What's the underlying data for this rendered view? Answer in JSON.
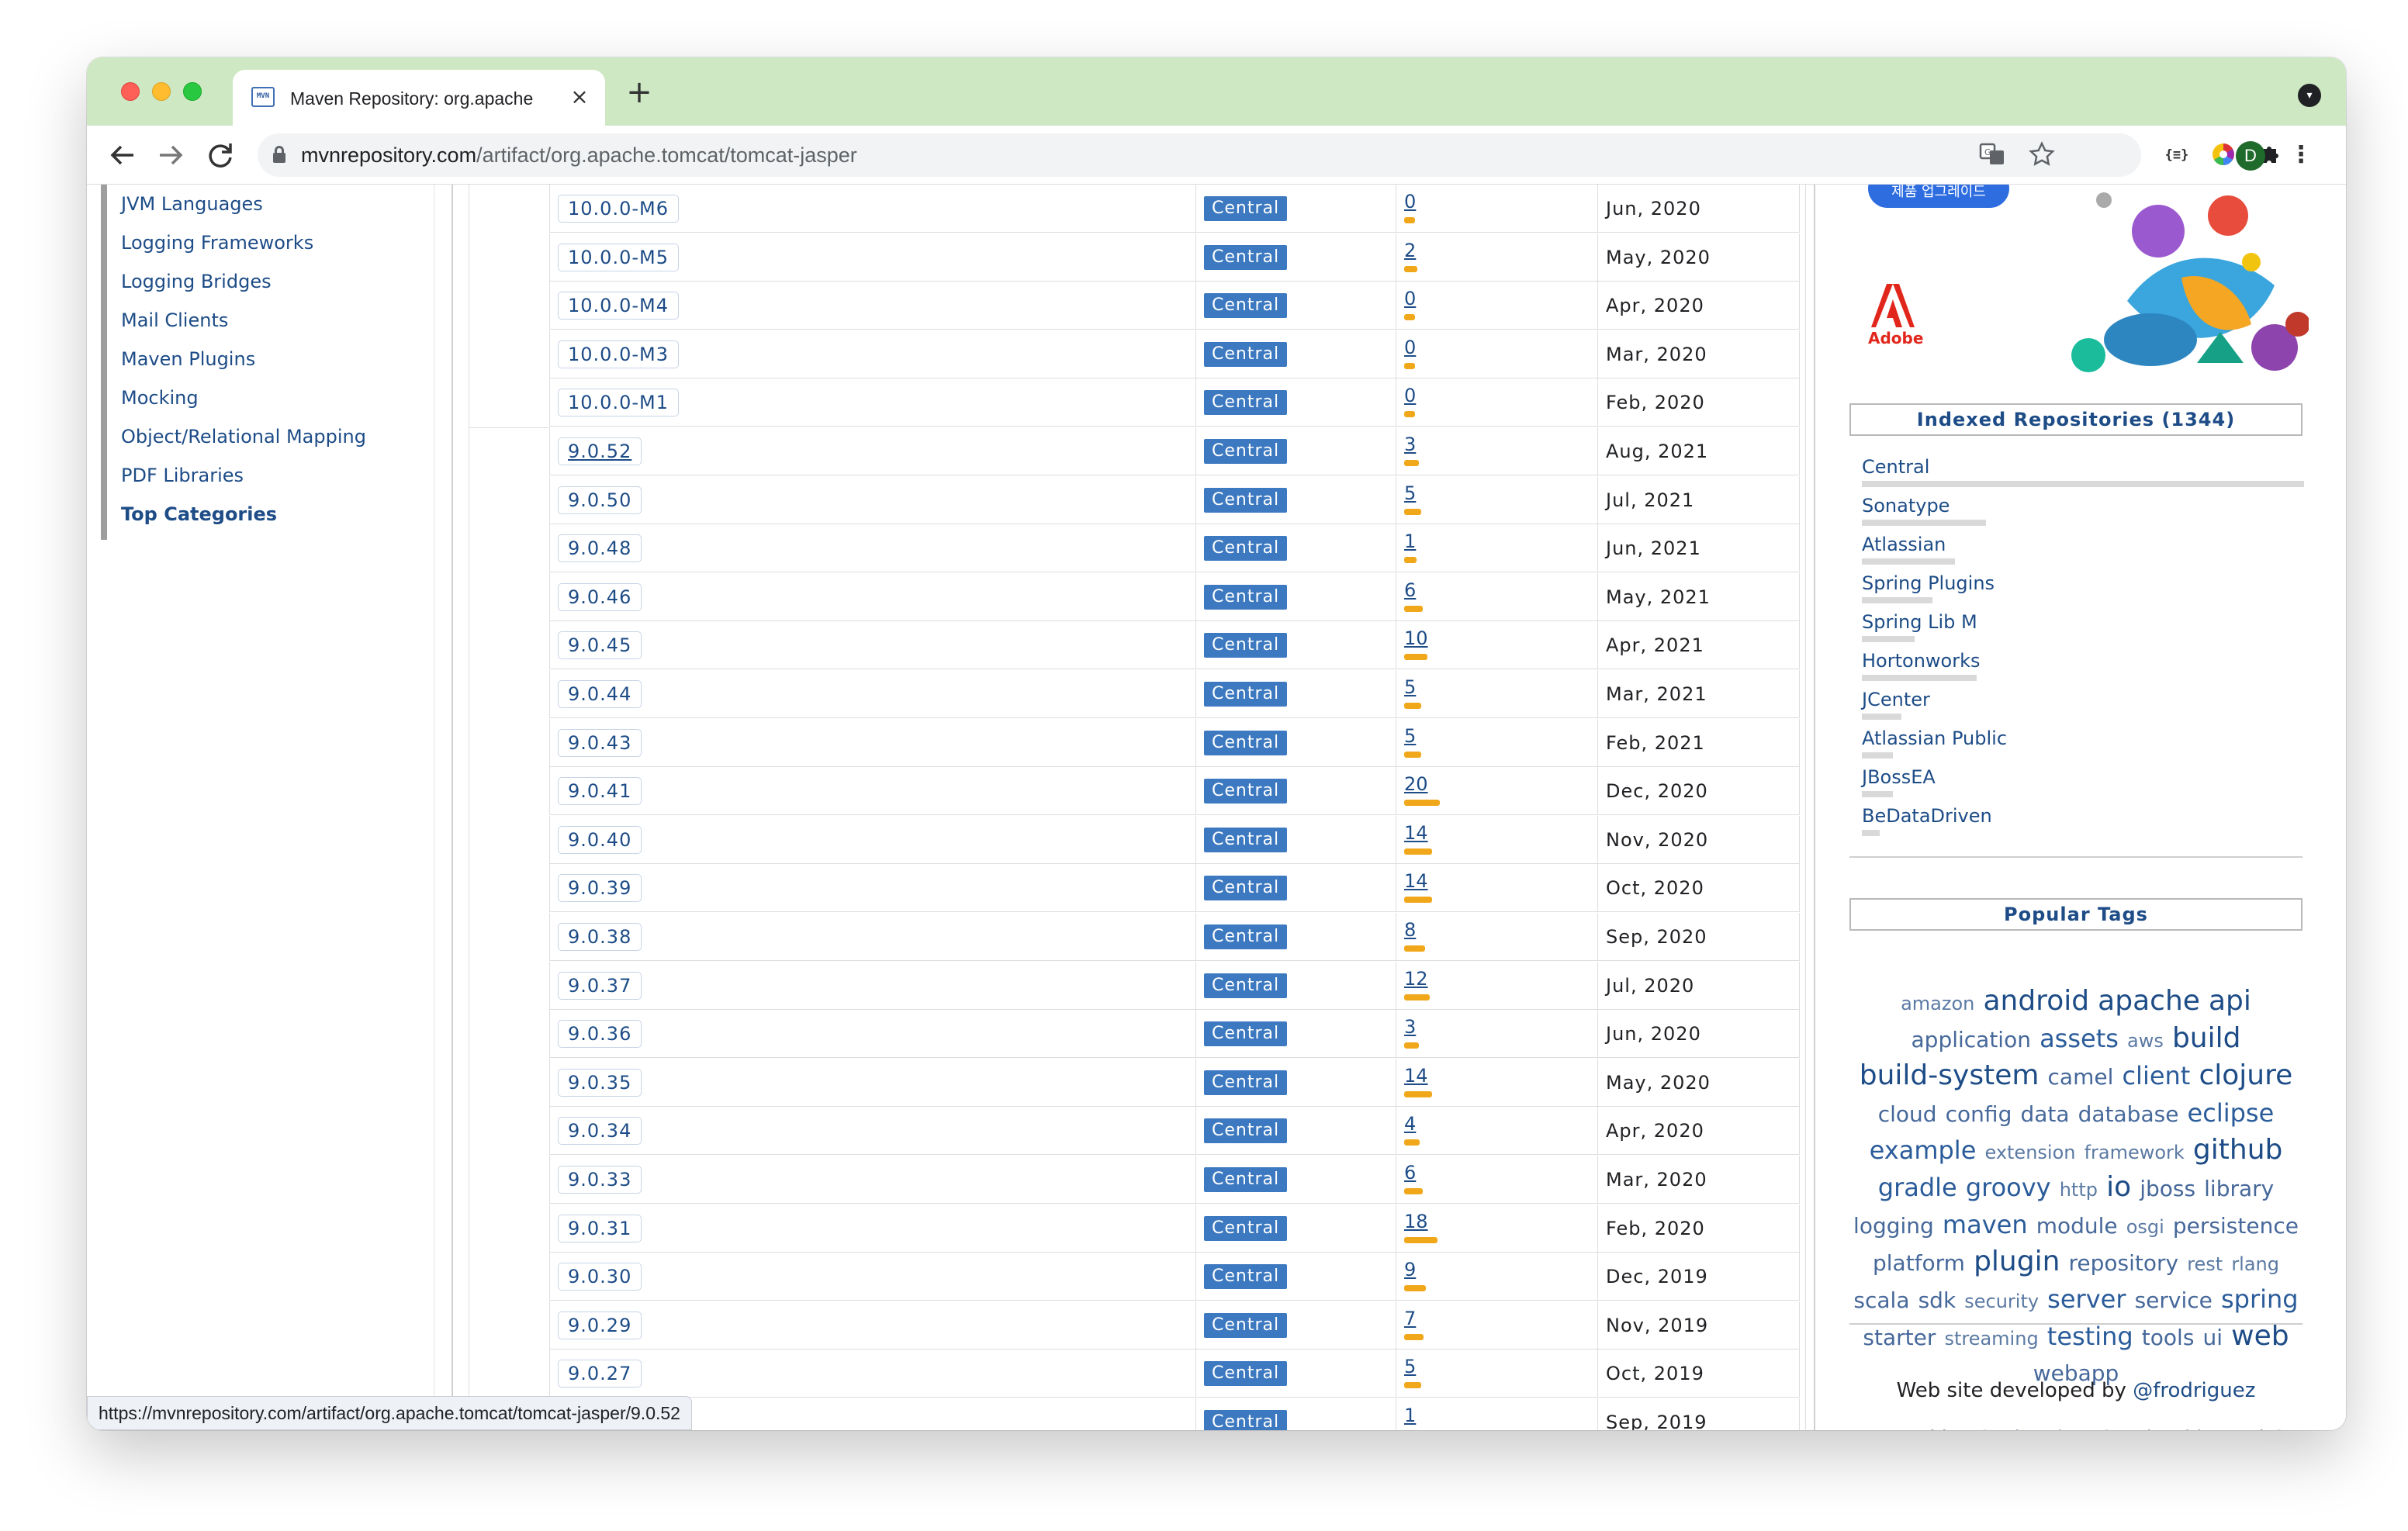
{
  "browser": {
    "tab_title": "Maven Repository: org.apache",
    "favicon_text": "MVN",
    "url_host": "mvnrepository.com",
    "url_path": "/artifact/org.apache.tomcat/tomcat-jasper",
    "avatar_letter": "D",
    "status_url": "https://mvnrepository.com/artifact/org.apache.tomcat/tomcat-jasper/9.0.52"
  },
  "left_nav": {
    "items": [
      "JVM Languages",
      "Logging Frameworks",
      "Logging Bridges",
      "Mail Clients",
      "Maven Plugins",
      "Mocking",
      "Object/Relational Mapping",
      "PDF Libraries",
      "Top Categories"
    ]
  },
  "versions": [
    {
      "version": "10.0.0-M6",
      "repo": "Central",
      "usages": "0",
      "usage_level": 0,
      "date": "Jun, 2020"
    },
    {
      "version": "10.0.0-M5",
      "repo": "Central",
      "usages": "2",
      "usage_level": 2,
      "date": "May, 2020"
    },
    {
      "version": "10.0.0-M4",
      "repo": "Central",
      "usages": "0",
      "usage_level": 0,
      "date": "Apr, 2020"
    },
    {
      "version": "10.0.0-M3",
      "repo": "Central",
      "usages": "0",
      "usage_level": 0,
      "date": "Mar, 2020"
    },
    {
      "version": "10.0.0-M1",
      "repo": "Central",
      "usages": "0",
      "usage_level": 0,
      "date": "Feb, 2020"
    },
    {
      "version": "9.0.52",
      "repo": "Central",
      "usages": "3",
      "usage_level": 3,
      "date": "Aug, 2021",
      "visited": true,
      "group_start": true
    },
    {
      "version": "9.0.50",
      "repo": "Central",
      "usages": "5",
      "usage_level": 5,
      "date": "Jul, 2021"
    },
    {
      "version": "9.0.48",
      "repo": "Central",
      "usages": "1",
      "usage_level": 1,
      "date": "Jun, 2021"
    },
    {
      "version": "9.0.46",
      "repo": "Central",
      "usages": "6",
      "usage_level": 6,
      "date": "May, 2021"
    },
    {
      "version": "9.0.45",
      "repo": "Central",
      "usages": "10",
      "usage_level": 10,
      "date": "Apr, 2021"
    },
    {
      "version": "9.0.44",
      "repo": "Central",
      "usages": "5",
      "usage_level": 5,
      "date": "Mar, 2021"
    },
    {
      "version": "9.0.43",
      "repo": "Central",
      "usages": "5",
      "usage_level": 5,
      "date": "Feb, 2021"
    },
    {
      "version": "9.0.41",
      "repo": "Central",
      "usages": "20",
      "usage_level": 20,
      "date": "Dec, 2020"
    },
    {
      "version": "9.0.40",
      "repo": "Central",
      "usages": "14",
      "usage_level": 14,
      "date": "Nov, 2020"
    },
    {
      "version": "9.0.39",
      "repo": "Central",
      "usages": "14",
      "usage_level": 14,
      "date": "Oct, 2020"
    },
    {
      "version": "9.0.38",
      "repo": "Central",
      "usages": "8",
      "usage_level": 8,
      "date": "Sep, 2020"
    },
    {
      "version": "9.0.37",
      "repo": "Central",
      "usages": "12",
      "usage_level": 12,
      "date": "Jul, 2020"
    },
    {
      "version": "9.0.36",
      "repo": "Central",
      "usages": "3",
      "usage_level": 3,
      "date": "Jun, 2020"
    },
    {
      "version": "9.0.35",
      "repo": "Central",
      "usages": "14",
      "usage_level": 14,
      "date": "May, 2020"
    },
    {
      "version": "9.0.34",
      "repo": "Central",
      "usages": "4",
      "usage_level": 4,
      "date": "Apr, 2020"
    },
    {
      "version": "9.0.33",
      "repo": "Central",
      "usages": "6",
      "usage_level": 6,
      "date": "Mar, 2020"
    },
    {
      "version": "9.0.31",
      "repo": "Central",
      "usages": "18",
      "usage_level": 18,
      "date": "Feb, 2020"
    },
    {
      "version": "9.0.30",
      "repo": "Central",
      "usages": "9",
      "usage_level": 9,
      "date": "Dec, 2019"
    },
    {
      "version": "9.0.29",
      "repo": "Central",
      "usages": "7",
      "usage_level": 7,
      "date": "Nov, 2019"
    },
    {
      "version": "9.0.27",
      "repo": "Central",
      "usages": "5",
      "usage_level": 5,
      "date": "Oct, 2019"
    },
    {
      "version": "",
      "repo": "Central",
      "usages": "1",
      "usage_level": 1,
      "date": "Sep, 2019"
    }
  ],
  "sidebar": {
    "ad_brand": "Adobe",
    "ad_pill_text": "제품 업그레이드",
    "indexed_title": "Indexed Repositories (1344)",
    "repositories": [
      {
        "name": "Central",
        "share": 1.0
      },
      {
        "name": "Sonatype",
        "share": 0.28
      },
      {
        "name": "Atlassian",
        "share": 0.21
      },
      {
        "name": "Spring Plugins",
        "share": 0.16
      },
      {
        "name": "Spring Lib M",
        "share": 0.12
      },
      {
        "name": "Hortonworks",
        "share": 0.26
      },
      {
        "name": "JCenter",
        "share": 0.09
      },
      {
        "name": "Atlassian Public",
        "share": 0.07
      },
      {
        "name": "JBossEA",
        "share": 0.07
      },
      {
        "name": "BeDataDriven",
        "share": 0.04
      }
    ],
    "popular_title": "Popular Tags",
    "tags": [
      {
        "t": "amazon",
        "s": 1
      },
      {
        "t": "android",
        "s": 4
      },
      {
        "t": "apache",
        "s": 4
      },
      {
        "t": "api",
        "s": 4
      },
      {
        "t": "application",
        "s": 2
      },
      {
        "t": "assets",
        "s": 3
      },
      {
        "t": "aws",
        "s": 1
      },
      {
        "t": "build",
        "s": 4
      },
      {
        "t": "build-system",
        "s": 4
      },
      {
        "t": "camel",
        "s": 2
      },
      {
        "t": "client",
        "s": 3
      },
      {
        "t": "clojure",
        "s": 4
      },
      {
        "t": "cloud",
        "s": 2
      },
      {
        "t": "config",
        "s": 2
      },
      {
        "t": "data",
        "s": 2
      },
      {
        "t": "database",
        "s": 2
      },
      {
        "t": "eclipse",
        "s": 3
      },
      {
        "t": "example",
        "s": 3
      },
      {
        "t": "extension",
        "s": 1
      },
      {
        "t": "framework",
        "s": 1
      },
      {
        "t": "github",
        "s": 4
      },
      {
        "t": "gradle",
        "s": 3
      },
      {
        "t": "groovy",
        "s": 3
      },
      {
        "t": "http",
        "s": 1
      },
      {
        "t": "io",
        "s": 4
      },
      {
        "t": "jboss",
        "s": 2
      },
      {
        "t": "library",
        "s": 2
      },
      {
        "t": "logging",
        "s": 2
      },
      {
        "t": "maven",
        "s": 3
      },
      {
        "t": "module",
        "s": 2
      },
      {
        "t": "osgi",
        "s": 1
      },
      {
        "t": "persistence",
        "s": 2
      },
      {
        "t": "platform",
        "s": 2
      },
      {
        "t": "plugin",
        "s": 4
      },
      {
        "t": "repository",
        "s": 2
      },
      {
        "t": "rest",
        "s": 1
      },
      {
        "t": "rlang",
        "s": 1
      },
      {
        "t": "scala",
        "s": 2
      },
      {
        "t": "sdk",
        "s": 2
      },
      {
        "t": "security",
        "s": 1
      },
      {
        "t": "server",
        "s": 3
      },
      {
        "t": "service",
        "s": 2
      },
      {
        "t": "spring",
        "s": 3
      },
      {
        "t": "starter",
        "s": 2
      },
      {
        "t": "streaming",
        "s": 1
      },
      {
        "t": "testing",
        "s": 3
      },
      {
        "t": "tools",
        "s": 2
      },
      {
        "t": "ui",
        "s": 2
      },
      {
        "t": "web",
        "s": 4
      },
      {
        "t": "webapp",
        "s": 2
      }
    ],
    "footer_developed": "Web site developed by",
    "footer_author": "@frodriguez",
    "footer_powered": "Powered by:",
    "footer_tech": [
      "Scala",
      "Play",
      "Spark",
      "Akka",
      "Cassandra"
    ],
    "footer_and": "and"
  },
  "colors": {
    "link": "#1d4c87",
    "repo_badge": "#3d79c0",
    "usage_bar": "#f0a81a",
    "tab_strip": "#cde8c3"
  }
}
